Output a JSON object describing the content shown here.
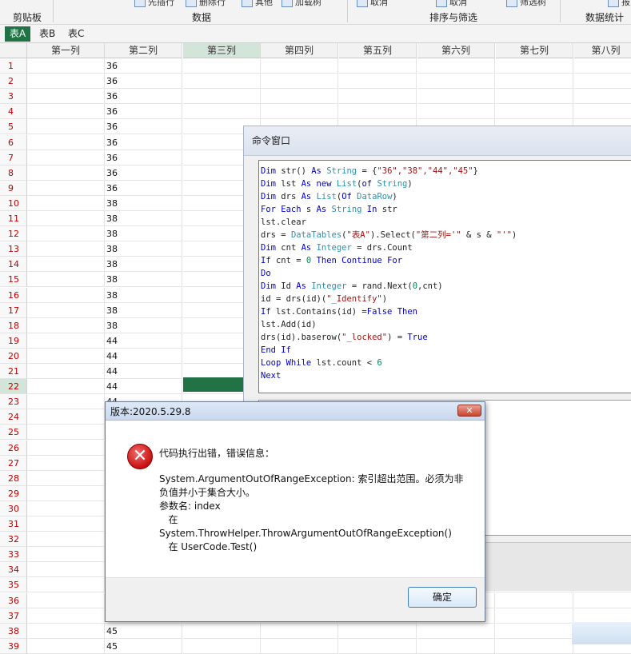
{
  "ribbon": {
    "clipboard_label": "剪贴板",
    "data_label": "数据",
    "sort_filter_label": "排序与筛选",
    "stats_label": "数据统计",
    "cut_buttons": [
      "先插行",
      "删除行",
      "其他",
      "加载树",
      "取消",
      "取消",
      "筛选树",
      "报"
    ]
  },
  "tabs": [
    "表A",
    "表B",
    "表C"
  ],
  "grid": {
    "columns": [
      "第一列",
      "第二列",
      "第三列",
      "第四列",
      "第五列",
      "第六列",
      "第七列",
      "第八列"
    ],
    "rows": [
      {
        "n": "1",
        "v": "36"
      },
      {
        "n": "2",
        "v": "36"
      },
      {
        "n": "3",
        "v": "36"
      },
      {
        "n": "4",
        "v": "36"
      },
      {
        "n": "5",
        "v": "36"
      },
      {
        "n": "6",
        "v": "36"
      },
      {
        "n": "7",
        "v": "36"
      },
      {
        "n": "8",
        "v": "36"
      },
      {
        "n": "9",
        "v": "36"
      },
      {
        "n": "10",
        "v": "38"
      },
      {
        "n": "11",
        "v": "38"
      },
      {
        "n": "12",
        "v": "38"
      },
      {
        "n": "13",
        "v": "38"
      },
      {
        "n": "14",
        "v": "38"
      },
      {
        "n": "15",
        "v": "38"
      },
      {
        "n": "16",
        "v": "38"
      },
      {
        "n": "17",
        "v": "38"
      },
      {
        "n": "18",
        "v": "38"
      },
      {
        "n": "19",
        "v": "44"
      },
      {
        "n": "20",
        "v": "44"
      },
      {
        "n": "21",
        "v": "44"
      },
      {
        "n": "22",
        "v": "44"
      },
      {
        "n": "23",
        "v": "44"
      },
      {
        "n": "24",
        "v": ""
      },
      {
        "n": "25",
        "v": ""
      },
      {
        "n": "26",
        "v": ""
      },
      {
        "n": "27",
        "v": ""
      },
      {
        "n": "28",
        "v": ""
      },
      {
        "n": "29",
        "v": ""
      },
      {
        "n": "30",
        "v": ""
      },
      {
        "n": "31",
        "v": ""
      },
      {
        "n": "32",
        "v": ""
      },
      {
        "n": "33",
        "v": ""
      },
      {
        "n": "34",
        "v": ""
      },
      {
        "n": "35",
        "v": ""
      },
      {
        "n": "36",
        "v": ""
      },
      {
        "n": "37",
        "v": ""
      },
      {
        "n": "38",
        "v": "45"
      },
      {
        "n": "39",
        "v": "45"
      }
    ]
  },
  "command_window": {
    "title": "命令窗口",
    "code_lines": [
      [
        [
          "k",
          "Dim "
        ],
        [
          "p",
          "str() "
        ],
        [
          "k",
          "As "
        ],
        [
          "t",
          "String"
        ],
        [
          "p",
          " = {"
        ],
        [
          "s",
          "\"36\",\"38\",\"44\",\"45\""
        ],
        [
          "p",
          "}"
        ]
      ],
      [
        [
          "k",
          "Dim "
        ],
        [
          "p",
          "lst "
        ],
        [
          "k",
          "As new "
        ],
        [
          "t",
          "List"
        ],
        [
          "p",
          "("
        ],
        [
          "k",
          "of "
        ],
        [
          "t",
          "String"
        ],
        [
          "p",
          ")"
        ]
      ],
      [
        [
          "k",
          "Dim "
        ],
        [
          "p",
          "drs "
        ],
        [
          "k",
          "As "
        ],
        [
          "t",
          "List"
        ],
        [
          "p",
          "("
        ],
        [
          "k",
          "Of "
        ],
        [
          "t",
          "DataRow"
        ],
        [
          "p",
          ")"
        ]
      ],
      [
        [
          "k",
          "For Each "
        ],
        [
          "p",
          "s "
        ],
        [
          "k",
          "As "
        ],
        [
          "t",
          "String "
        ],
        [
          "k",
          "In "
        ],
        [
          "p",
          "str"
        ]
      ],
      [
        [
          "p",
          "lst.clear"
        ]
      ],
      [
        [
          "p",
          "drs = "
        ],
        [
          "t",
          "DataTables"
        ],
        [
          "p",
          "("
        ],
        [
          "s",
          "\"表A\""
        ],
        [
          "p",
          ").Select("
        ],
        [
          "s",
          "\"第二列='\""
        ],
        [
          "p",
          " & s & "
        ],
        [
          "s",
          "\"'\""
        ],
        [
          "p",
          ")"
        ]
      ],
      [
        [
          "k",
          "Dim "
        ],
        [
          "p",
          "cnt "
        ],
        [
          "k",
          "As "
        ],
        [
          "t",
          "Integer"
        ],
        [
          "p",
          " = drs.Count"
        ]
      ],
      [
        [
          "k",
          "If "
        ],
        [
          "p",
          "cnt = "
        ],
        [
          "n",
          "0 "
        ],
        [
          "k",
          "Then Continue For"
        ]
      ],
      [
        [
          "k",
          "Do"
        ]
      ],
      [
        [
          "k",
          "Dim "
        ],
        [
          "p",
          "Id "
        ],
        [
          "k",
          "As "
        ],
        [
          "t",
          "Integer"
        ],
        [
          "p",
          " = rand.Next("
        ],
        [
          "n",
          "0"
        ],
        [
          "p",
          ",cnt)"
        ]
      ],
      [
        [
          "p",
          "id = drs(id)("
        ],
        [
          "s",
          "\"_Identify\""
        ],
        [
          "p",
          ")"
        ]
      ],
      [
        [
          "k",
          "If "
        ],
        [
          "p",
          "lst.Contains(id) ="
        ],
        [
          "k",
          "False Then"
        ]
      ],
      [
        [
          "p",
          "lst.Add(id)"
        ]
      ],
      [
        [
          "p",
          "drs(id).baserow("
        ],
        [
          "s",
          "\"_locked\""
        ],
        [
          "p",
          ") = "
        ],
        [
          "k",
          "True"
        ]
      ],
      [
        [
          "k",
          "End If"
        ]
      ],
      [
        [
          "k",
          "Loop While "
        ],
        [
          "p",
          "lst.count < "
        ],
        [
          "n",
          "6"
        ]
      ],
      [
        [
          "k",
          "Next"
        ]
      ]
    ]
  },
  "dialog": {
    "title": "版本:2020.5.29.8",
    "close_label": "✕",
    "message": "代码执行出错，错误信息：",
    "details": [
      "System.ArgumentOutOfRangeException: 索引超出范围。必须为非",
      "负值并小于集合大小。",
      "参数名: index",
      "   在",
      "System.ThrowHelper.ThrowArgumentOutOfRangeException()",
      "   在 UserCode.Test()"
    ],
    "ok_label": "确定",
    "icon": "error-icon"
  }
}
